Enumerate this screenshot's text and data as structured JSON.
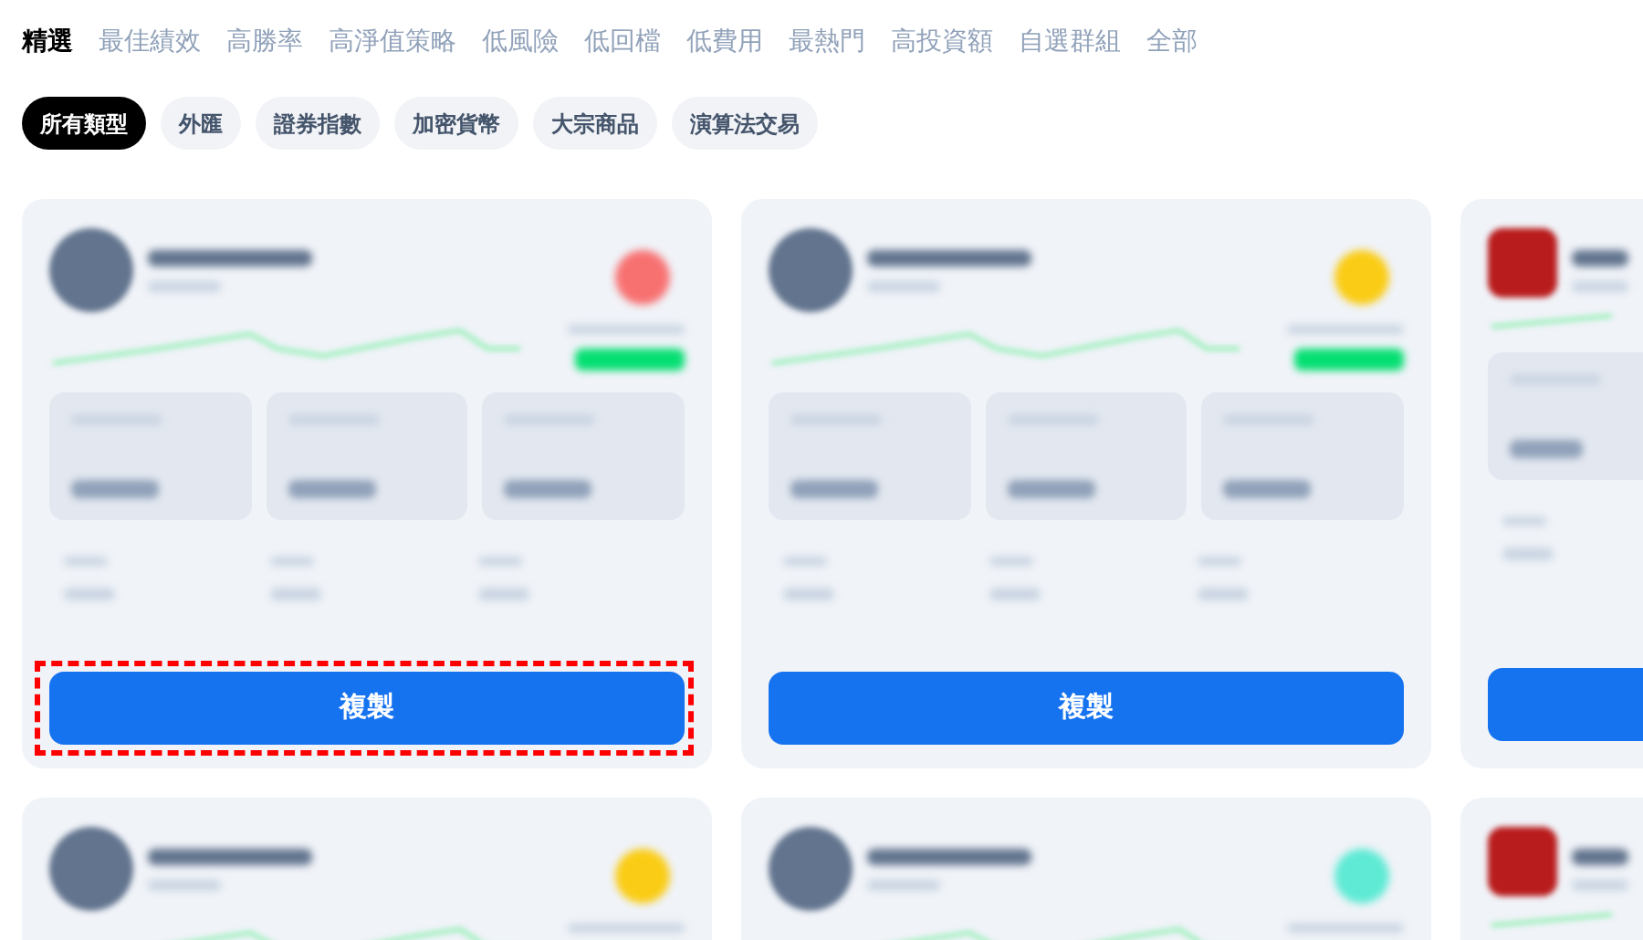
{
  "tabs": [
    {
      "label": "精選",
      "selected": true
    },
    {
      "label": "最佳績效",
      "selected": false
    },
    {
      "label": "高勝率",
      "selected": false
    },
    {
      "label": "高淨值策略",
      "selected": false
    },
    {
      "label": "低風險",
      "selected": false
    },
    {
      "label": "低回檔",
      "selected": false
    },
    {
      "label": "低費用",
      "selected": false
    },
    {
      "label": "最熱門",
      "selected": false
    },
    {
      "label": "高投資額",
      "selected": false
    },
    {
      "label": "自選群組",
      "selected": false
    },
    {
      "label": "全部",
      "selected": false
    }
  ],
  "filters": [
    {
      "label": "所有類型",
      "selected": true
    },
    {
      "label": "外匯",
      "selected": false
    },
    {
      "label": "證券指數",
      "selected": false
    },
    {
      "label": "加密貨幣",
      "selected": false
    },
    {
      "label": "大宗商品",
      "selected": false
    },
    {
      "label": "演算法交易",
      "selected": false
    }
  ],
  "cards": [
    {
      "kind": "full",
      "color": "#f87171",
      "button": "複製",
      "highlighted": true
    },
    {
      "kind": "full",
      "color": "#facc15",
      "button": "複製",
      "highlighted": false
    },
    {
      "kind": "clipped",
      "has_button": true
    },
    {
      "kind": "full",
      "color": "#facc15"
    },
    {
      "kind": "full",
      "color": "#5eead4"
    },
    {
      "kind": "clipped"
    }
  ]
}
